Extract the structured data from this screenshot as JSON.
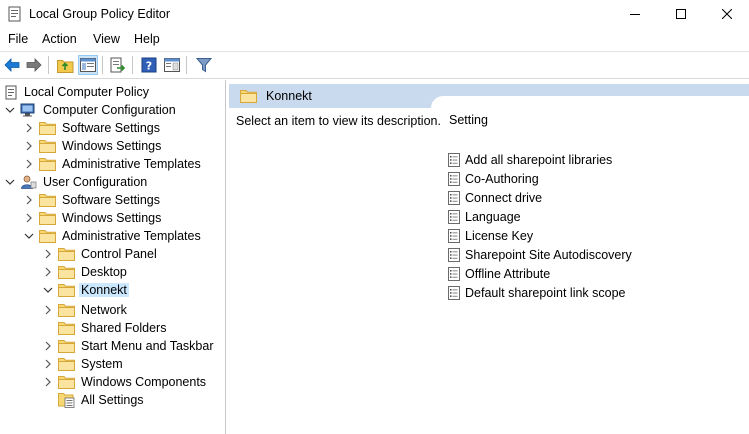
{
  "window": {
    "title": "Local Group Policy Editor",
    "accent": "#0078d7"
  },
  "menu": [
    "File",
    "Action",
    "View",
    "Help"
  ],
  "toolbar": {
    "buttons": [
      "back-arrow-icon",
      "forward-arrow-icon",
      "up-folder-icon",
      "show-hide-tree-icon",
      "export-list-icon",
      "help-icon",
      "extended-view-icon",
      "filter-icon"
    ]
  },
  "tree": {
    "root": "Local Computer Policy",
    "computer_config": "Computer Configuration",
    "cc_software": "Software Settings",
    "cc_windows": "Windows Settings",
    "cc_admin": "Administrative Templates",
    "user_config": "User Configuration",
    "uc_software": "Software Settings",
    "uc_windows": "Windows Settings",
    "uc_admin": "Administrative Templates",
    "control_panel": "Control Panel",
    "desktop": "Desktop",
    "konnekt": "Konnekt",
    "network": "Network",
    "shared_folders": "Shared Folders",
    "start_menu": "Start Menu and Taskbar",
    "system": "System",
    "windows_components": "Windows Components",
    "all_settings": "All Settings"
  },
  "details": {
    "title": "Konnekt",
    "description": "Select an item to view its description.",
    "column_header": "Setting",
    "settings": [
      "Add all sharepoint libraries",
      "Co-Authoring",
      "Connect drive",
      "Language",
      "License Key",
      "Sharepoint Site Autodiscovery",
      "Offline Attribute",
      "Default sharepoint link scope"
    ]
  }
}
